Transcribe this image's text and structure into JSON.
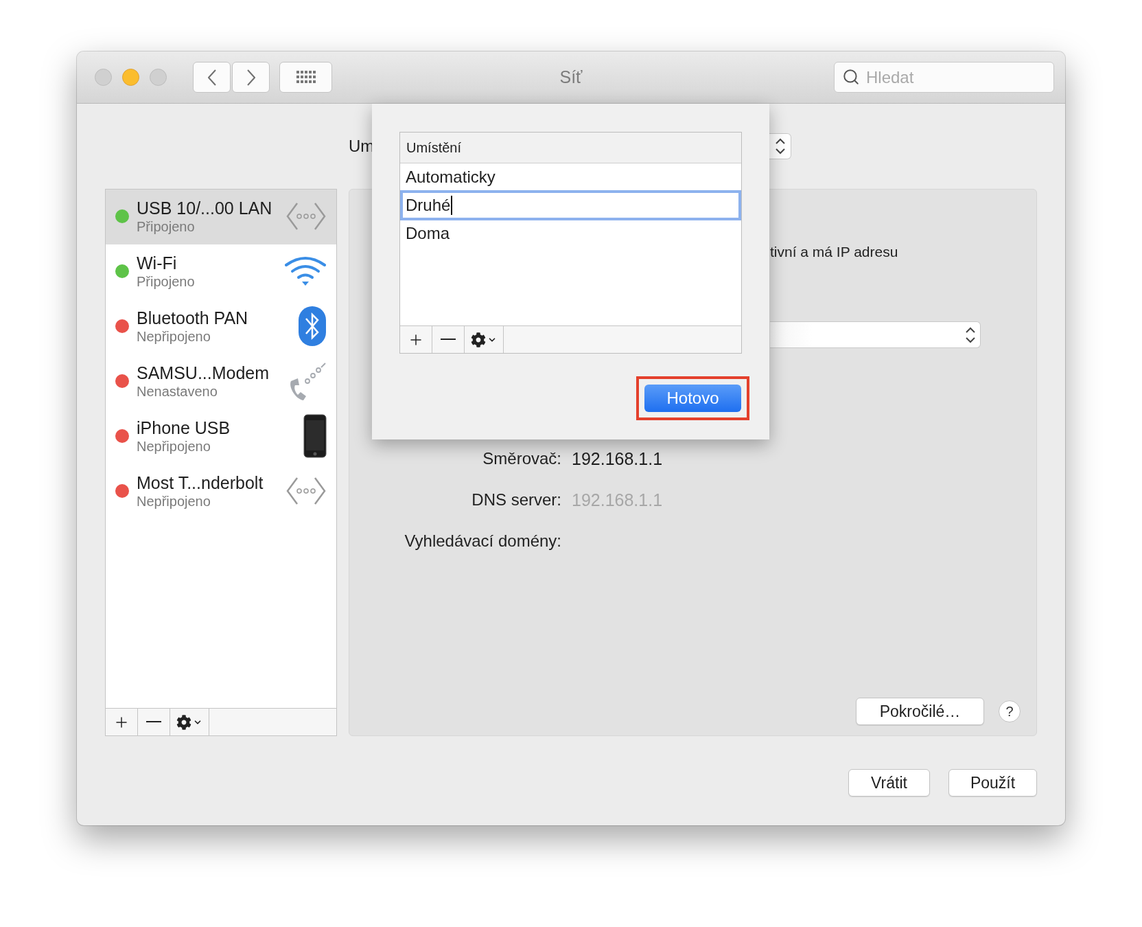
{
  "window": {
    "title": "Síť",
    "search": {
      "placeholder": "Hledat"
    }
  },
  "location": {
    "label": "Um"
  },
  "sidebar": {
    "items": [
      {
        "name": "USB 10/...00 LAN",
        "status": "Připojeno",
        "color": "#5ec348",
        "kind": "ethernet",
        "selected": true
      },
      {
        "name": "Wi-Fi",
        "status": "Připojeno",
        "color": "#5ec348",
        "kind": "wifi",
        "selected": false
      },
      {
        "name": "Bluetooth PAN",
        "status": "Nepřipojeno",
        "color": "#e9524a",
        "kind": "bluetooth",
        "selected": false
      },
      {
        "name": "SAMSU...Modem",
        "status": "Nenastaveno",
        "color": "#e9524a",
        "kind": "modem",
        "selected": false
      },
      {
        "name": "iPhone USB",
        "status": "Nepřipojeno",
        "color": "#e9524a",
        "kind": "iphone",
        "selected": false
      },
      {
        "name": "Most T...nderbolt",
        "status": "Nepřipojeno",
        "color": "#e9524a",
        "kind": "ethernet",
        "selected": false
      }
    ]
  },
  "panel": {
    "status": "tivní a má IP adresu",
    "fields": [
      {
        "label": "Směrovač:",
        "value": "192.168.1.1",
        "dimmed": false
      },
      {
        "label": "DNS server:",
        "value": "192.168.1.1",
        "dimmed": true
      },
      {
        "label": "Vyhledávací domény:"
      }
    ],
    "advanced_button": "Pokročilé…",
    "help_button": "?"
  },
  "buttons": [
    "Vrátit",
    "Použít"
  ],
  "sheet": {
    "column": "Umístění",
    "rows": [
      {
        "name": "Automaticky",
        "selected": false
      },
      {
        "name": "Druhé",
        "selected": true
      },
      {
        "name": "Doma",
        "selected": false
      }
    ],
    "done_button": "Hotovo",
    "done_highlighted": true
  }
}
